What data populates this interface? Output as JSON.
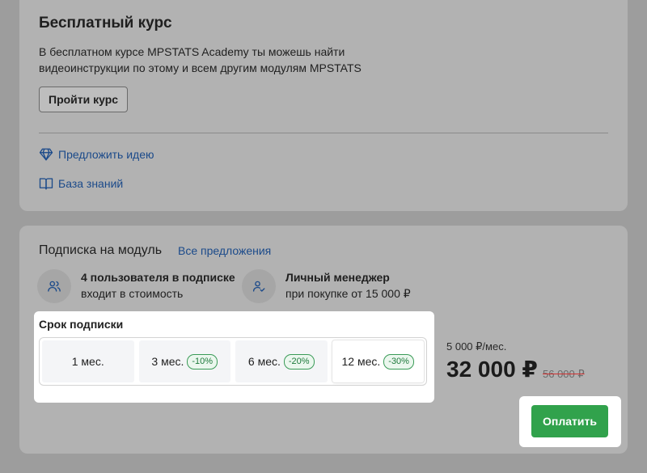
{
  "free_course": {
    "title": "Бесплатный курс",
    "description_line1": "В бесплатном курсе MPSTATS Academy ты можешь найти",
    "description_line2": "видеоинструкции по этому и всем другим модулям MPSTATS",
    "button_label": "Пройти курс",
    "link_idea": "Предложить идею",
    "link_knowledge_base": "База знаний"
  },
  "subscription": {
    "title": "Подписка на модуль",
    "all_offers_link": "Все предложения",
    "feature_users_title": "4 пользователя в подписке",
    "feature_users_sub": "входит в стоимость",
    "feature_manager_title": "Личный менеджер",
    "feature_manager_sub": "при покупке от 15 000 ₽",
    "term_label": "Срок подписки",
    "terms": [
      {
        "label": "1 мес.",
        "discount": ""
      },
      {
        "label": "3 мес.",
        "discount": "-10%"
      },
      {
        "label": "6 мес.",
        "discount": "-20%"
      },
      {
        "label": "12 мес.",
        "discount": "-30%"
      }
    ],
    "selected_term_index": 3,
    "per_month": "5 000 ₽/мес.",
    "price": "32 000 ₽",
    "old_price": "56 000 ₽",
    "pay_button": "Оплатить"
  },
  "icons": {
    "idea": "diamond-icon",
    "knowledge_base": "book-icon",
    "users": "users-icon",
    "manager": "user-check-icon"
  },
  "colors": {
    "accent_link": "#1b4a8a",
    "pay_button": "#31a24c",
    "discount_badge": "#1e7a3c"
  }
}
